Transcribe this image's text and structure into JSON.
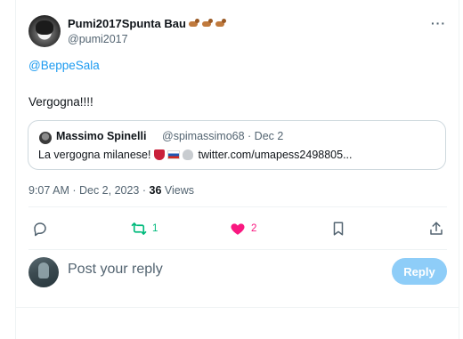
{
  "author": {
    "display_name": "Pumi2017Spunta Bau",
    "name_emojis": [
      "dog-emoji",
      "dog-emoji",
      "dog-emoji"
    ],
    "handle": "@pumi2017"
  },
  "tweet": {
    "mention": "@BeppeSala",
    "text": "Vergogna!!!!"
  },
  "quote": {
    "name": "Massimo Spinelli",
    "handle_date": "@spimassimo68 · Dec 2",
    "text": "La vergogna milanese!",
    "emojis": [
      "mask-emoji",
      "russia-flag-emoji",
      "skull-emoji"
    ],
    "link": "twitter.com/umapess2498805..."
  },
  "meta": {
    "time_date": "9:07 AM · Dec 2, 2023 · ",
    "views_count": "36",
    "views_label": " Views"
  },
  "actions": {
    "reply_count": "",
    "retweet_count": "1",
    "like_count": "2",
    "retweet_color": "#00ba7c",
    "like_color": "#f91880"
  },
  "reply": {
    "placeholder": "Post your reply",
    "button_label": "Reply",
    "button_color": "#8ecdf8"
  },
  "icons": {
    "more": "more-horizontal-icon",
    "reply": "reply-icon",
    "retweet": "retweet-icon",
    "like": "heart-filled-icon",
    "bookmark": "bookmark-icon",
    "share": "share-icon"
  }
}
